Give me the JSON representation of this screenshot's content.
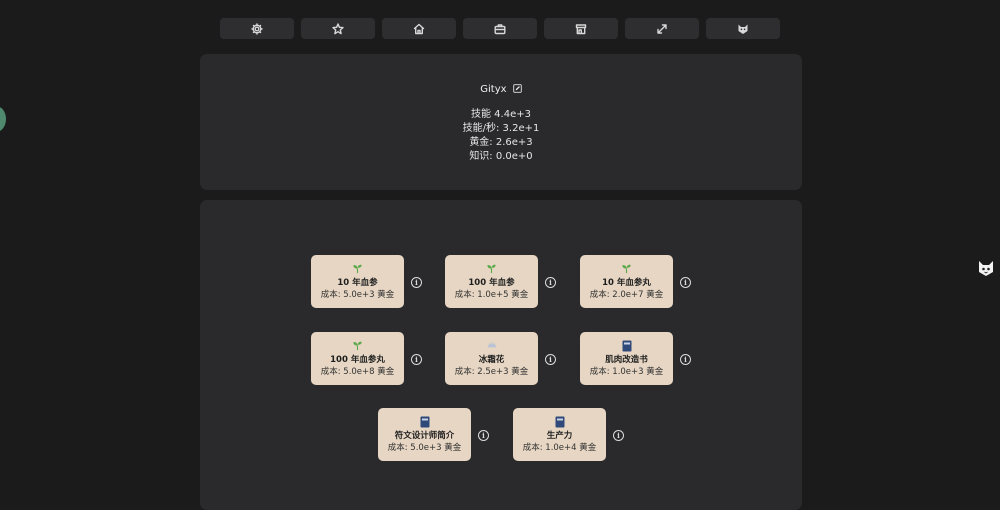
{
  "toolbar": [
    {
      "icon": "gear-icon"
    },
    {
      "icon": "star-icon"
    },
    {
      "icon": "home-icon"
    },
    {
      "icon": "briefcase-icon"
    },
    {
      "icon": "store-icon"
    },
    {
      "icon": "expand-arrows-icon"
    },
    {
      "icon": "cat-icon"
    }
  ],
  "profile": {
    "name": "Gityx",
    "stats": [
      "技能 4.4e+3",
      "技能/秒: 3.2e+1",
      "黄金: 2.6e+3",
      "知识: 0.0e+0"
    ]
  },
  "shop": {
    "items": [
      {
        "icon": "sprout-icon",
        "title": "10 年血参",
        "cost": "成本: 5.0e+3 黄金"
      },
      {
        "icon": "sprout-icon",
        "title": "100 年血参",
        "cost": "成本: 1.0e+5 黄金"
      },
      {
        "icon": "sprout-icon",
        "title": "10 年血参丸",
        "cost": "成本: 2.0e+7 黄金"
      },
      {
        "icon": "sprout-icon",
        "title": "100 年血参丸",
        "cost": "成本: 5.0e+8 黄金"
      },
      {
        "icon": "snowflake-icon",
        "title": "冰霜花",
        "cost": "成本: 2.5e+3 黄金"
      },
      {
        "icon": "book-icon",
        "title": "肌肉改造书",
        "cost": "成本: 1.0e+3 黄金"
      },
      {
        "icon": "book-icon",
        "title": "符文设计师简介",
        "cost": "成本: 5.0e+3 黄金"
      },
      {
        "icon": "book-icon",
        "title": "生产力",
        "cost": "成本: 1.0e+4 黄金"
      }
    ]
  },
  "colors": {
    "background": "#1b1b1c",
    "panel": "#2a2a2c",
    "card": "#e6d6c3",
    "sprout": "#5aa84a",
    "book": "#2f4a7a"
  }
}
